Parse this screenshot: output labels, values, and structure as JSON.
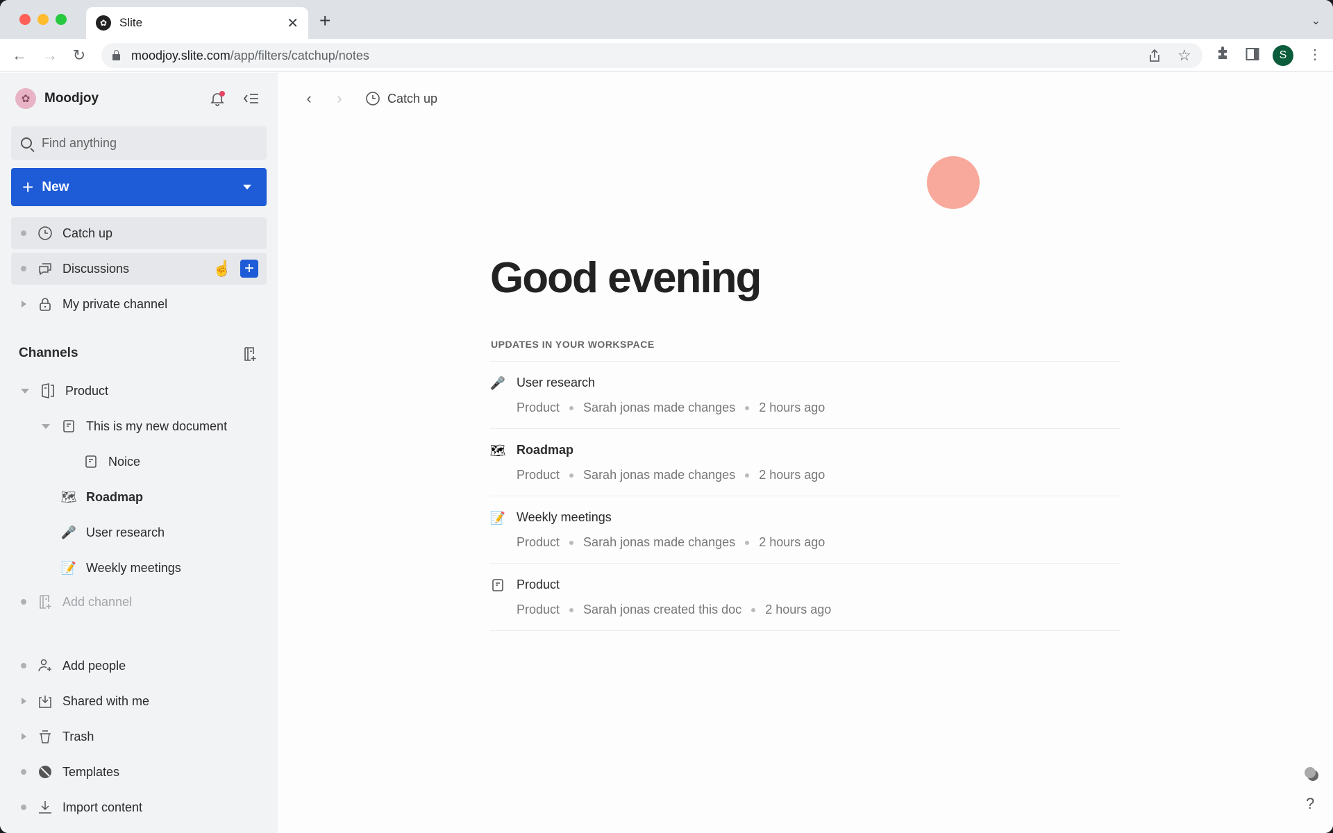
{
  "browser": {
    "tab_title": "Slite",
    "url_host": "moodjoy.slite.com",
    "url_path": "/app/filters/catchup/notes",
    "profile_initial": "S",
    "icons": [
      "back-icon",
      "forward-icon",
      "reload-icon",
      "lock-icon",
      "share-icon",
      "star-icon",
      "extensions-icon",
      "sidebar-icon",
      "menu-icon"
    ]
  },
  "sidebar": {
    "workspace_name": "Moodjoy",
    "search_placeholder": "Find anything",
    "new_button_label": "New",
    "top_items": [
      {
        "label": "Catch up",
        "icon": "clock-icon"
      },
      {
        "label": "Discussions",
        "icon": "chat-icon"
      },
      {
        "label": "My private channel",
        "icon": "lock-icon"
      }
    ],
    "channels_title": "Channels",
    "channels": [
      {
        "label": "Product",
        "icon": "channel-icon"
      },
      {
        "label": "This is my new document",
        "icon": "doc-icon"
      },
      {
        "label": "Noice",
        "icon": "doc-icon"
      },
      {
        "label": "Roadmap",
        "icon": "map-emoji"
      },
      {
        "label": "User research",
        "icon": "microphone-emoji"
      },
      {
        "label": "Weekly meetings",
        "icon": "memo-emoji"
      }
    ],
    "add_channel_label": "Add channel",
    "bottom_items": [
      {
        "label": "Add people",
        "icon": "add-person-icon"
      },
      {
        "label": "Shared with me",
        "icon": "inbox-icon"
      },
      {
        "label": "Trash",
        "icon": "trash-icon"
      },
      {
        "label": "Templates",
        "icon": "templates-icon"
      },
      {
        "label": "Import content",
        "icon": "import-icon"
      }
    ]
  },
  "main": {
    "breadcrumb_title": "Catch up",
    "greeting": "Good evening",
    "updates_title": "UPDATES IN YOUR WORKSPACE",
    "updates": [
      {
        "title": "User research",
        "icon": "microphone-emoji",
        "channel": "Product",
        "action": "Sarah jonas made changes",
        "time": "2 hours ago"
      },
      {
        "title": "Roadmap",
        "icon": "map-emoji",
        "channel": "Product",
        "action": "Sarah jonas made changes",
        "time": "2 hours ago"
      },
      {
        "title": "Weekly meetings",
        "icon": "memo-emoji",
        "channel": "Product",
        "action": "Sarah jonas made changes",
        "time": "2 hours ago"
      },
      {
        "title": "Product",
        "icon": "doc-icon",
        "channel": "Product",
        "action": "Sarah jonas created this doc",
        "time": "2 hours ago"
      }
    ],
    "help_label": "?"
  },
  "colors": {
    "accent": "#1e5bd6",
    "blob": "#f8a99c",
    "notification_dot": "#e64564",
    "profile": "#0b5c3b"
  }
}
